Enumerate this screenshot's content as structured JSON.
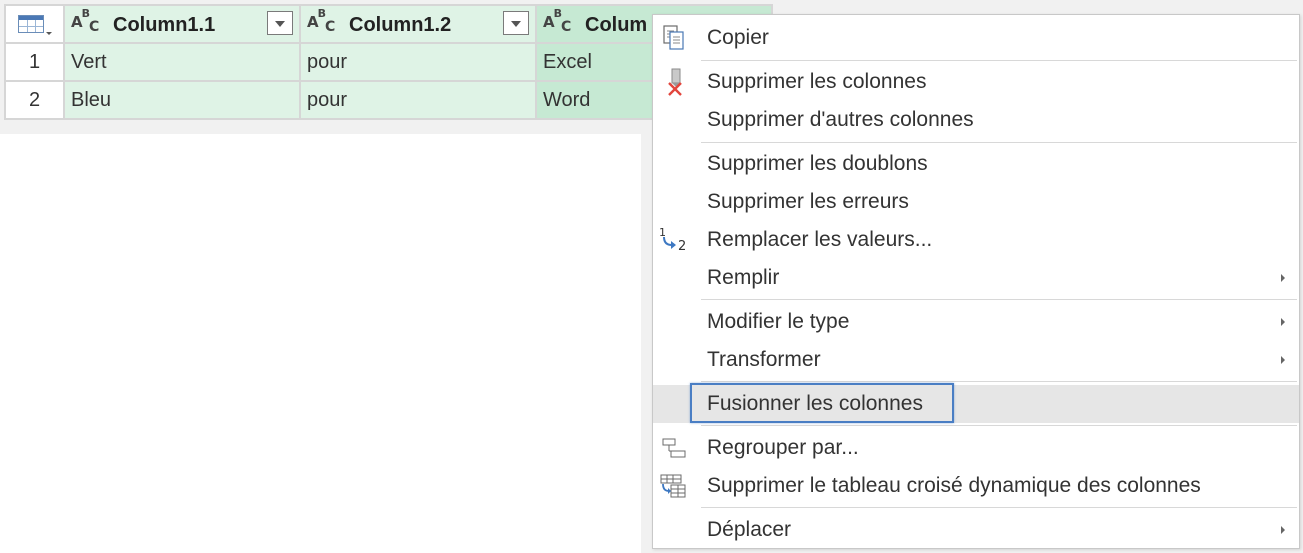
{
  "table": {
    "columns": [
      {
        "type_label": "ABC",
        "name": "Column1.1"
      },
      {
        "type_label": "ABC",
        "name": "Column1.2"
      },
      {
        "type_label": "ABC",
        "name": "Colum"
      }
    ],
    "rows": [
      {
        "num": "1",
        "cells": [
          "Vert",
          "pour",
          "Excel"
        ]
      },
      {
        "num": "2",
        "cells": [
          "Bleu",
          "pour",
          "Word"
        ]
      }
    ]
  },
  "context_menu": {
    "items": [
      {
        "label": "Copier",
        "icon": "copy-icon",
        "submenu": false
      },
      {
        "label": "Supprimer les colonnes",
        "icon": "delete-columns-icon",
        "submenu": false
      },
      {
        "label": "Supprimer d'autres colonnes",
        "icon": "",
        "submenu": false
      },
      {
        "label": "Supprimer les doublons",
        "icon": "",
        "submenu": false
      },
      {
        "label": "Supprimer les erreurs",
        "icon": "",
        "submenu": false
      },
      {
        "label": "Remplacer les valeurs...",
        "icon": "replace-values-icon",
        "submenu": false
      },
      {
        "label": "Remplir",
        "icon": "",
        "submenu": true
      },
      {
        "label": "Modifier le type",
        "icon": "",
        "submenu": true
      },
      {
        "label": "Transformer",
        "icon": "",
        "submenu": true
      },
      {
        "label": "Fusionner les colonnes",
        "icon": "",
        "submenu": false,
        "highlighted": true
      },
      {
        "label": "Regrouper par...",
        "icon": "group-by-icon",
        "submenu": false
      },
      {
        "label": "Supprimer le tableau croisé dynamique des colonnes",
        "icon": "unpivot-icon",
        "submenu": false
      },
      {
        "label": "Déplacer",
        "icon": "",
        "submenu": true
      }
    ]
  },
  "colors": {
    "column_header_bg": "#dff3e6",
    "selected_column_bg": "#c6e9d3",
    "highlight_border": "#4a7ec4",
    "delete_red": "#e2453c"
  }
}
